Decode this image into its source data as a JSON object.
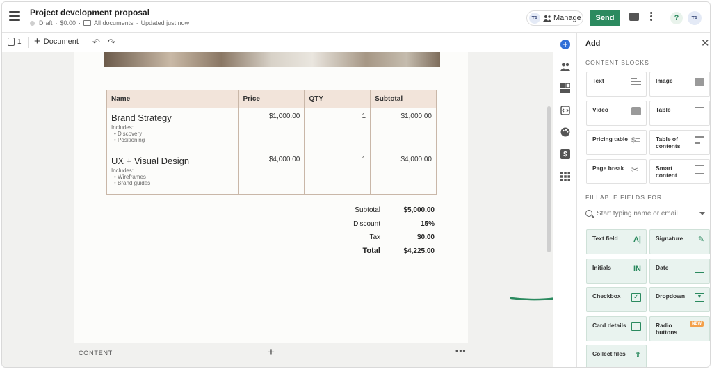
{
  "header": {
    "title": "Project development proposal",
    "status": "Draft",
    "price": "$0.00",
    "folder": "All documents",
    "updated": "Updated just now",
    "avatar_initials": "TA",
    "manage_label": "Manage",
    "send_label": "Send",
    "help_label": "?",
    "user_initials": "TA"
  },
  "toolbar": {
    "page_count": "1",
    "document_label": "Document"
  },
  "table": {
    "headers": [
      "Name",
      "Price",
      "QTY",
      "Subtotal"
    ],
    "rows": [
      {
        "name": "Brand Strategy",
        "includes_label": "Includes:",
        "includes": [
          "Discovery",
          "Positioning"
        ],
        "price": "$1,000.00",
        "qty": "1",
        "subtotal": "$1,000.00"
      },
      {
        "name": "UX + Visual Design",
        "includes_label": "Includes:",
        "includes": [
          "Wireframes",
          "Brand guides"
        ],
        "price": "$4,000.00",
        "qty": "1",
        "subtotal": "$4,000.00"
      }
    ]
  },
  "totals": {
    "subtotal_label": "Subtotal",
    "subtotal_value": "$5,000.00",
    "discount_label": "Discount",
    "discount_value": "15%",
    "tax_label": "Tax",
    "tax_value": "$0.00",
    "total_label": "Total",
    "total_value": "$4,225.00"
  },
  "content_bar": {
    "label": "CONTENT"
  },
  "panel": {
    "title": "Add",
    "content_blocks_label": "CONTENT BLOCKS",
    "content_blocks": [
      "Text",
      "Image",
      "Video",
      "Table",
      "Pricing table",
      "Table of contents",
      "Page break",
      "Smart content"
    ],
    "fillable_label": "FILLABLE FIELDS FOR",
    "search_placeholder": "Start typing name or email",
    "fields": [
      "Text field",
      "Signature",
      "Initials",
      "Date",
      "Checkbox",
      "Dropdown",
      "Card details",
      "Radio buttons",
      "Collect files"
    ],
    "new_badge": "NEW"
  },
  "colors": {
    "accent": "#2b8a5f",
    "rail_active": "#2f6fd8",
    "field_bg": "#e9f3ef",
    "table_header": "#f2e4da"
  }
}
